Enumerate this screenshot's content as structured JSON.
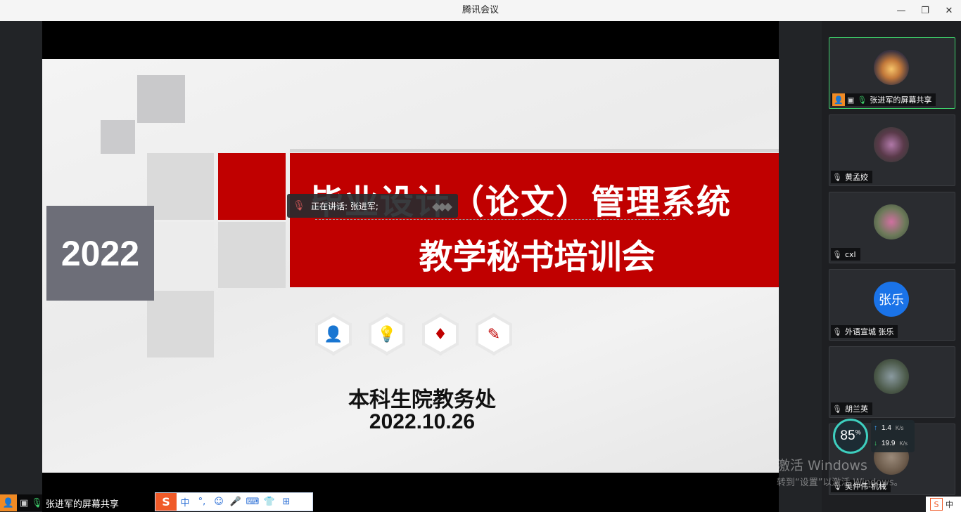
{
  "window": {
    "title": "腾讯会议",
    "minimize": "—",
    "restore": "❐",
    "close": "✕"
  },
  "slide": {
    "year": "2022",
    "title_line1": "毕业设计（论文）管理系统",
    "title_line2": "教学秘书培训会",
    "department": "本科生院教务处",
    "date": "2022.10.26",
    "icons": [
      "person-icon",
      "lightbulb-icon",
      "tie-icon",
      "pen-icon"
    ]
  },
  "speaking": {
    "label": "正在讲话: 张进军;"
  },
  "participants": [
    {
      "name": "张进军的屏幕共享",
      "avatar_text": "",
      "avatar_color": "#c2783a",
      "active": true
    },
    {
      "name": "黄孟姣",
      "avatar_text": "",
      "avatar_color": "#5a3a4a",
      "active": false
    },
    {
      "name": "cxl",
      "avatar_text": "",
      "avatar_color": "#6d7a5a",
      "active": false
    },
    {
      "name": "外语宣城 张乐",
      "avatar_text": "张乐",
      "avatar_color": "#1a73e8",
      "active": false
    },
    {
      "name": "胡兰英",
      "avatar_text": "",
      "avatar_color": "#4c5a4a",
      "active": false
    },
    {
      "name": "吴仲伟-机械",
      "avatar_text": "",
      "avatar_color": "#6b5a4a",
      "active": false
    }
  ],
  "network": {
    "score": "85",
    "score_unit": "%",
    "upload": "1.4",
    "download": "19.9",
    "unit": "K/s"
  },
  "watermark": {
    "line1": "激活 Windows",
    "line2": "转到“设置”以激活 Windows。"
  },
  "share_label": "张进军的屏幕共享",
  "ime": {
    "logo": "S",
    "items": [
      "中",
      "°,",
      "☺",
      "🎤",
      "⌨",
      "👕",
      "⊞"
    ]
  },
  "ime_tray": {
    "logo": "S",
    "mode": "中"
  },
  "colors": {
    "accent_red": "#c00000",
    "active_green": "#3ecf6b",
    "host_orange": "#f08a24"
  }
}
